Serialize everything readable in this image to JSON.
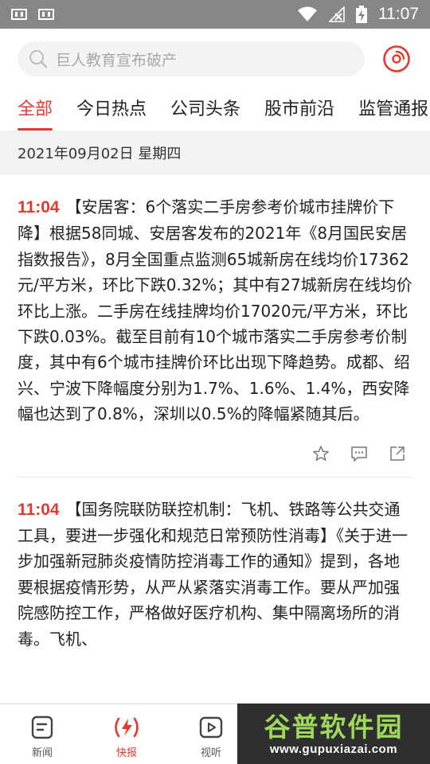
{
  "status_bar": {
    "time": "11:07",
    "colors": {
      "background": "#878787"
    }
  },
  "search": {
    "placeholder": "巨人教育宣布破产"
  },
  "tabs": [
    {
      "label": "全部",
      "active": true
    },
    {
      "label": "今日热点",
      "active": false
    },
    {
      "label": "公司头条",
      "active": false
    },
    {
      "label": "股市前沿",
      "active": false
    },
    {
      "label": "监管通报",
      "active": false
    }
  ],
  "date_header": "2021年09月02日 星期四",
  "news": [
    {
      "time": "11:04",
      "text": "【安居客：6个落实二手房参考价城市挂牌价下降】根据58同城、安居客发布的2021年《8月国民安居指数报告》，8月全国重点监测65城新房在线均价17362元/平方米，环比下跌0.32%；其中有27城新房在线均价环比上涨。二手房在线挂牌均价17020元/平方米，环比下跌0.03%。截至目前有10个城市落实二手房参考价制度，其中有6个城市挂牌价环比出现下降趋势。成都、绍兴、宁波下降幅度分别为1.7%、1.6%、1.4%，西安降幅也达到了0.8%，深圳以0.5%的降幅紧随其后。"
    },
    {
      "time": "11:04",
      "text": "【国务院联防联控机制：飞机、铁路等公共交通工具，要进一步强化和规范日常预防性消毒】《关于进一步加强新冠肺炎疫情防控消毒工作的通知》提到，各地要根据疫情形势，从严从紧落实消毒工作。要从严加强院感防控工作，严格做好医疗机构、集中隔离场所的消毒。飞机、"
    }
  ],
  "bottom_nav": [
    {
      "label": "新闻",
      "icon": "document-icon",
      "active": false
    },
    {
      "label": "快报",
      "icon": "pulse-icon",
      "active": true
    },
    {
      "label": "视听",
      "icon": "play-icon",
      "active": false
    }
  ],
  "watermark": {
    "title": "谷普软件园",
    "url": "www.gupuxiazai.com"
  },
  "colors": {
    "accent": "#e4392f",
    "date_bar": "#f2f2f2",
    "search_bg": "#f3f3f3",
    "watermark_green": "#9fd95a"
  }
}
